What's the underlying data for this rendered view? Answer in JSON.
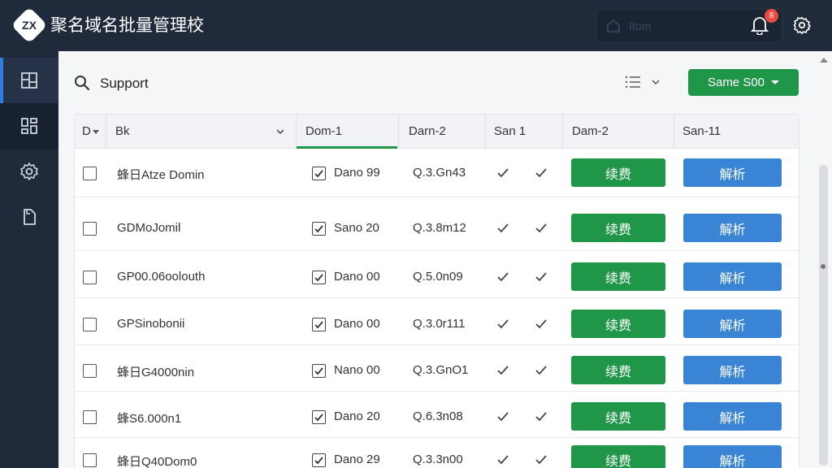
{
  "app": {
    "title": "聚名域名批量管理校",
    "logo_mark": "ZX"
  },
  "topbar": {
    "search_placeholder": "Itom",
    "notification_badge": "8"
  },
  "sidebar": {
    "items": [
      {
        "name": "sidebar-item-domains",
        "icon": "layout-icon",
        "active": true
      },
      {
        "name": "sidebar-item-dashboard",
        "icon": "grid-icon",
        "active": false
      },
      {
        "name": "sidebar-item-settings",
        "icon": "gear-icon",
        "active": false
      },
      {
        "name": "sidebar-item-files",
        "icon": "file-icon",
        "active": false
      }
    ]
  },
  "toolbar": {
    "search_text": "Support",
    "save_label": "Same S00"
  },
  "table": {
    "columns": [
      "D",
      "Bk",
      "Dom-1",
      "Darn-2",
      "San 1",
      "Dam-2",
      "San-11"
    ],
    "rows": [
      {
        "name": "蜂日Atze Domin",
        "status": "Dano 99",
        "code": "Q.3.Gn43"
      },
      {
        "name": "GDMoJomil",
        "status": "Sano 20",
        "code": "Q.3.8m12"
      },
      {
        "name": "GP00.06oolouth",
        "status": "Dano 00",
        "code": "Q.5.0n09"
      },
      {
        "name": "GPSinobonii",
        "status": "Dano 00",
        "code": "Q.3.0r111"
      },
      {
        "name": "蜂日G4000nin",
        "status": "Nano 00",
        "code": "Q.3.GnO1"
      },
      {
        "name": "蜂S6.000n1",
        "status": "Dano 20",
        "code": "Q.6.3n08"
      },
      {
        "name": "蜂日Q40Dom0",
        "status": "Dano 29",
        "code": "Q.3.3n00"
      }
    ],
    "renew_label": "续费",
    "dns_label": "解析"
  },
  "colors": {
    "sidebar_bg": "#1f2a3b",
    "accent_green": "#1f9648",
    "accent_blue": "#3a84d6",
    "active_indicator": "#2f7de1",
    "badge_red": "#e84a3d"
  }
}
